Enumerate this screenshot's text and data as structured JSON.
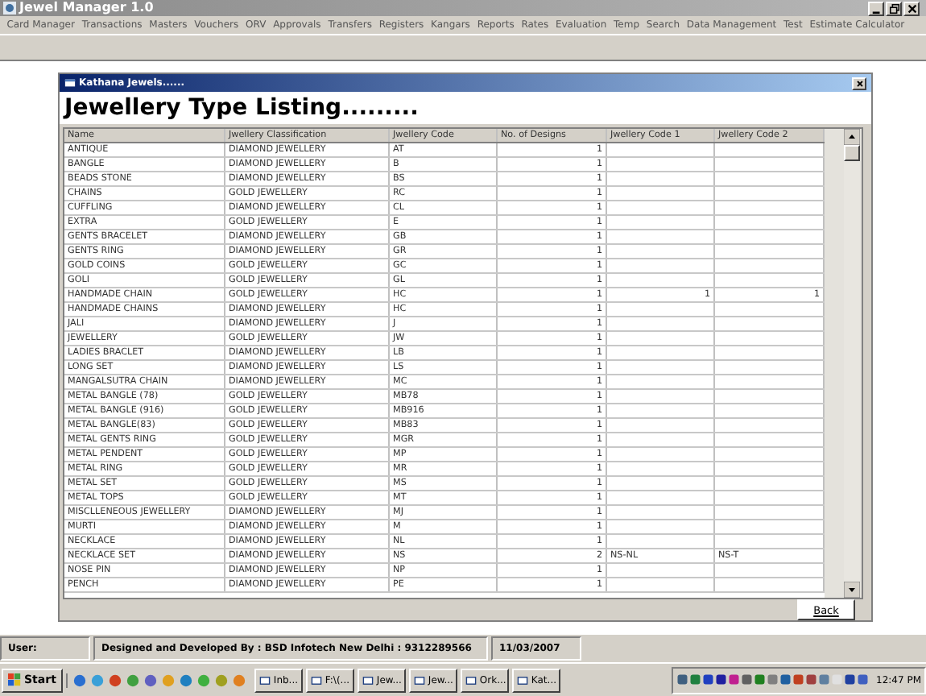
{
  "app": {
    "title": "Jewel Manager 1.0"
  },
  "menu": [
    "Card Manager",
    "Transactions",
    "Masters",
    "Vouchers",
    "ORV",
    "Approvals",
    "Transfers",
    "Registers",
    "Kangars",
    "Reports",
    "Rates",
    "Evaluation",
    "Temp",
    "Search",
    "Data Management",
    "Test",
    "Estimate Calculator"
  ],
  "dialog": {
    "title": "Kathana Jewels......",
    "heading": "Jewellery Type Listing.........",
    "back_button": "Back"
  },
  "table": {
    "columns": [
      "Name",
      "Jwellery Classification",
      "Jwellery Code",
      "No. of Designs",
      "Jwellery Code 1",
      "Jwellery Code 2"
    ],
    "rows": [
      [
        "ANTIQUE",
        "DIAMOND JEWELLERY",
        "AT",
        "1",
        "",
        ""
      ],
      [
        "BANGLE",
        "DIAMOND JEWELLERY",
        "B",
        "1",
        "",
        ""
      ],
      [
        "BEADS STONE",
        "DIAMOND JEWELLERY",
        "BS",
        "1",
        "",
        ""
      ],
      [
        "CHAINS",
        "GOLD JEWELLERY",
        "RC",
        "1",
        "",
        ""
      ],
      [
        "CUFFLING",
        "DIAMOND JEWELLERY",
        "CL",
        "1",
        "",
        ""
      ],
      [
        "EXTRA",
        "GOLD JEWELLERY",
        "E",
        "1",
        "",
        ""
      ],
      [
        "GENTS BRACELET",
        "DIAMOND JEWELLERY",
        "GB",
        "1",
        "",
        ""
      ],
      [
        "GENTS RING",
        "DIAMOND JEWELLERY",
        "GR",
        "1",
        "",
        ""
      ],
      [
        "GOLD COINS",
        "GOLD JEWELLERY",
        "GC",
        "1",
        "",
        ""
      ],
      [
        "GOLI",
        "GOLD JEWELLERY",
        "GL",
        "1",
        "",
        ""
      ],
      [
        "HANDMADE CHAIN",
        "GOLD JEWELLERY",
        "HC",
        "1",
        "1",
        "1"
      ],
      [
        "HANDMADE CHAINS",
        "DIAMOND JEWELLERY",
        "HC",
        "1",
        "",
        ""
      ],
      [
        "JALI",
        "DIAMOND JEWELLERY",
        "J",
        "1",
        "",
        ""
      ],
      [
        "JEWELLERY",
        "GOLD JEWELLERY",
        "JW",
        "1",
        "",
        ""
      ],
      [
        "LADIES BRACLET",
        "DIAMOND JEWELLERY",
        "LB",
        "1",
        "",
        ""
      ],
      [
        "LONG SET",
        "DIAMOND JEWELLERY",
        "LS",
        "1",
        "",
        ""
      ],
      [
        "MANGALSUTRA CHAIN",
        "DIAMOND JEWELLERY",
        "MC",
        "1",
        "",
        ""
      ],
      [
        "METAL BANGLE (78)",
        "GOLD JEWELLERY",
        "MB78",
        "1",
        "",
        ""
      ],
      [
        "METAL BANGLE (916)",
        "GOLD JEWELLERY",
        "MB916",
        "1",
        "",
        ""
      ],
      [
        "METAL BANGLE(83)",
        "GOLD JEWELLERY",
        "MB83",
        "1",
        "",
        ""
      ],
      [
        "METAL GENTS RING",
        "GOLD JEWELLERY",
        "MGR",
        "1",
        "",
        ""
      ],
      [
        "METAL PENDENT",
        "GOLD JEWELLERY",
        "MP",
        "1",
        "",
        ""
      ],
      [
        "METAL RING",
        "GOLD JEWELLERY",
        "MR",
        "1",
        "",
        ""
      ],
      [
        "METAL SET",
        "GOLD JEWELLERY",
        "MS",
        "1",
        "",
        ""
      ],
      [
        "METAL TOPS",
        "GOLD JEWELLERY",
        "MT",
        "1",
        "",
        ""
      ],
      [
        "MISCLLENEOUS JEWELLERY",
        "DIAMOND JEWELLERY",
        "MJ",
        "1",
        "",
        ""
      ],
      [
        "MURTI",
        "DIAMOND JEWELLERY",
        "M",
        "1",
        "",
        ""
      ],
      [
        "NECKLACE",
        "DIAMOND JEWELLERY",
        "NL",
        "1",
        "",
        ""
      ],
      [
        "NECKLACE SET",
        "DIAMOND JEWELLERY",
        "NS",
        "2",
        "NS-NL",
        "NS-T"
      ],
      [
        "NOSE PIN",
        "DIAMOND JEWELLERY",
        "NP",
        "1",
        "",
        ""
      ],
      [
        "PENCH",
        "DIAMOND JEWELLERY",
        "PE",
        "1",
        "",
        ""
      ]
    ]
  },
  "status_bar": {
    "user_label": "User:",
    "credit": "Designed and Developed By : BSD Infotech New Delhi : 9312289566",
    "date": "11/03/2007"
  },
  "taskbar": {
    "start": "Start",
    "tasks": [
      "Inb...",
      "F:\\(...",
      "Jew...",
      "Jew...",
      "Ork...",
      "Kat..."
    ],
    "clock": "12:47 PM"
  }
}
